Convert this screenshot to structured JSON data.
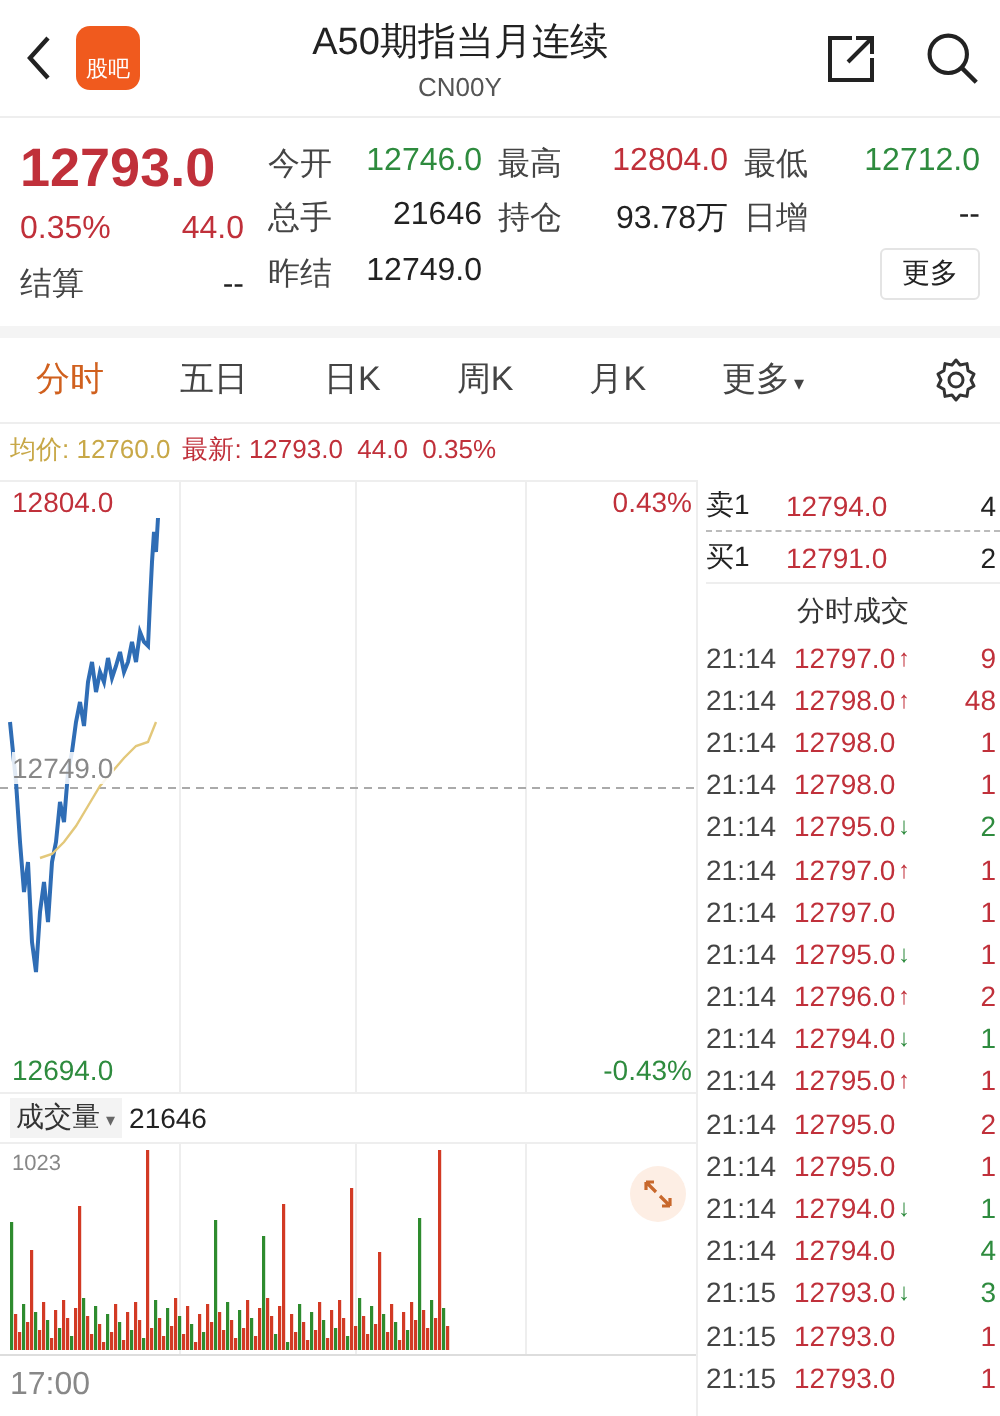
{
  "header": {
    "logo": "股吧",
    "title": "A50期指当月连续",
    "code": "CN00Y"
  },
  "quote": {
    "price": "12793.0",
    "change_pct": "0.35%",
    "change": "44.0",
    "settle_label": "结算",
    "settle_value": "--",
    "stats": [
      {
        "label": "今开",
        "value": "12746.0",
        "color": "#2e8b3e"
      },
      {
        "label": "最高",
        "value": "12804.0",
        "color": "#c0303a"
      },
      {
        "label": "最低",
        "value": "12712.0",
        "color": "#2e8b3e"
      },
      {
        "label": "总手",
        "value": "21646",
        "color": "#222222"
      },
      {
        "label": "持仓",
        "value": "93.78万",
        "color": "#222222"
      },
      {
        "label": "日增",
        "value": "--",
        "color": "#222222"
      },
      {
        "label": "昨结",
        "value": "12749.0",
        "color": "#222222"
      }
    ],
    "more_button": "更多"
  },
  "tabs": [
    {
      "label": "分时",
      "selected": true
    },
    {
      "label": "五日",
      "selected": false
    },
    {
      "label": "日K",
      "selected": false
    },
    {
      "label": "周K",
      "selected": false
    },
    {
      "label": "月K",
      "selected": false
    },
    {
      "label": "更多",
      "caret": "▾",
      "selected": false
    }
  ],
  "info_line": {
    "avg_label": "均价:",
    "avg_value": "12760.0",
    "last_label": "最新:",
    "last_value": "12793.0",
    "change": "44.0",
    "change_pct": "0.35%"
  },
  "price_chart": {
    "high": "12804.0",
    "high_pct": "0.43%",
    "prev_close": "12749.0",
    "low": "12694.0",
    "low_pct": "-0.43%"
  },
  "order_book": [
    {
      "label": "卖1",
      "price": "12794.0",
      "volume": "4"
    },
    {
      "label": "买1",
      "price": "12791.0",
      "volume": "2"
    }
  ],
  "trades_title": "分时成交",
  "trades": [
    {
      "time": "21:14",
      "price": "12797.0",
      "arrow": "↑",
      "up": true,
      "volume": "9",
      "color": "#c0303a"
    },
    {
      "time": "21:14",
      "price": "12798.0",
      "arrow": "↑",
      "up": true,
      "volume": "48",
      "color": "#c0303a"
    },
    {
      "time": "21:14",
      "price": "12798.0",
      "volume": "1",
      "color": "#c0303a"
    },
    {
      "time": "21:14",
      "price": "12798.0",
      "volume": "1",
      "color": "#c0303a"
    },
    {
      "time": "21:14",
      "price": "12795.0",
      "arrow": "↓",
      "up": false,
      "volume": "2",
      "color": "#2e8b3e"
    },
    {
      "time": "21:14",
      "price": "12797.0",
      "arrow": "↑",
      "up": true,
      "volume": "1",
      "color": "#c0303a"
    },
    {
      "time": "21:14",
      "price": "12797.0",
      "volume": "1",
      "color": "#c0303a"
    },
    {
      "time": "21:14",
      "price": "12795.0",
      "arrow": "↓",
      "up": false,
      "volume": "1",
      "color": "#c0303a"
    },
    {
      "time": "21:14",
      "price": "12796.0",
      "arrow": "↑",
      "up": true,
      "volume": "2",
      "color": "#c0303a"
    },
    {
      "time": "21:14",
      "price": "12794.0",
      "arrow": "↓",
      "up": false,
      "volume": "1",
      "color": "#2e8b3e"
    },
    {
      "time": "21:14",
      "price": "12795.0",
      "arrow": "↑",
      "up": true,
      "volume": "1",
      "color": "#c0303a"
    },
    {
      "time": "21:14",
      "price": "12795.0",
      "volume": "2",
      "color": "#c0303a"
    },
    {
      "time": "21:14",
      "price": "12795.0",
      "volume": "1",
      "color": "#c0303a"
    },
    {
      "time": "21:14",
      "price": "12794.0",
      "arrow": "↓",
      "up": false,
      "volume": "1",
      "color": "#2e8b3e"
    },
    {
      "time": "21:14",
      "price": "12794.0",
      "volume": "4",
      "color": "#2e8b3e"
    },
    {
      "time": "21:15",
      "price": "12793.0",
      "arrow": "↓",
      "up": false,
      "volume": "3",
      "color": "#2e8b3e"
    },
    {
      "time": "21:15",
      "price": "12793.0",
      "volume": "1",
      "color": "#c0303a"
    },
    {
      "time": "21:15",
      "price": "12793.0",
      "volume": "1",
      "color": "#c0303a"
    }
  ],
  "volume_panel": {
    "selector": "成交量",
    "caret": "▾",
    "total": "21646",
    "max": "1023",
    "start_time": "17:00"
  }
}
